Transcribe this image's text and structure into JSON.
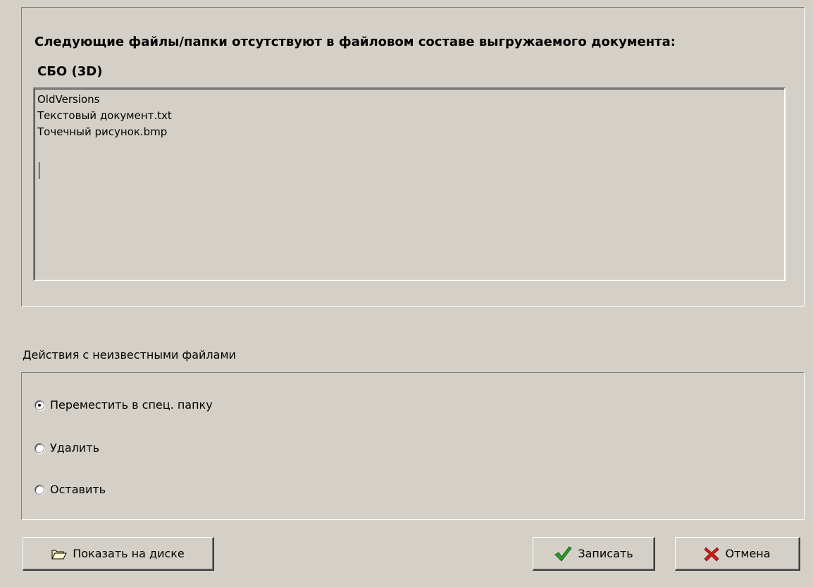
{
  "header": {
    "heading": "Следующие файлы/папки отсутствуют в файловом составе выгружаемого документа:",
    "document_name": "СБО (3D)"
  },
  "missing_files": {
    "lines": [
      "OldVersions",
      "Текстовый документ.txt",
      "Точечный рисунок.bmp"
    ]
  },
  "actions": {
    "group_label": "Действия с неизвестными файлами",
    "options": [
      {
        "label": "Переместить в спец. папку",
        "selected": true
      },
      {
        "label": "Удалить",
        "selected": false
      },
      {
        "label": "Оставить",
        "selected": false
      }
    ]
  },
  "buttons": {
    "show_on_disk": "Показать на диске",
    "save": "Записать",
    "cancel": "Отмена"
  },
  "icons": {
    "show_on_disk": "folder-open-icon",
    "save": "checkmark-icon",
    "cancel": "cross-icon"
  },
  "colors": {
    "background": "#d4d0c8",
    "check_green": "#2e9b2e",
    "cross_red": "#d01c1c"
  }
}
